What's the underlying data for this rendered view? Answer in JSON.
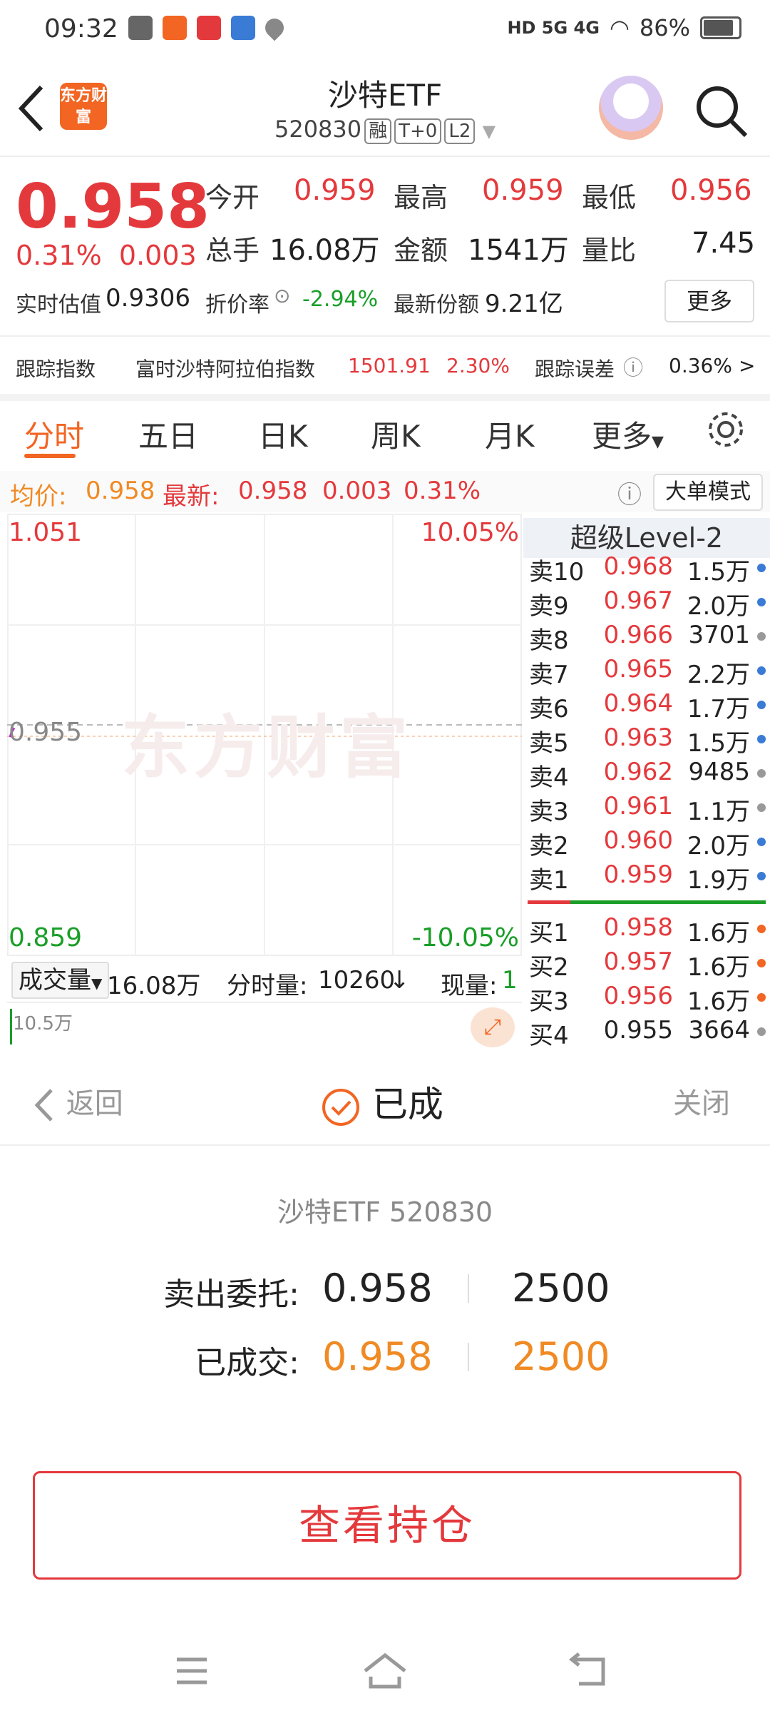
{
  "status_bar": {
    "time": "09:32",
    "network": "HD 5G 4G",
    "battery": "86%"
  },
  "header": {
    "logo_text": "东方财富",
    "title": "沙特ETF",
    "code": "520830",
    "tags": [
      "融",
      "T+0",
      "L2"
    ]
  },
  "quote": {
    "price": "0.958",
    "change_pct": "0.31%",
    "change": "0.003",
    "open_label": "今开",
    "open": "0.959",
    "high_label": "最高",
    "high": "0.959",
    "low_label": "最低",
    "low": "0.956",
    "volume_label": "总手",
    "volume": "16.08万",
    "amount_label": "金额",
    "amount": "1541万",
    "ratio_label": "量比",
    "ratio": "7.45",
    "iopv_label": "实时估值",
    "iopv": "0.9306",
    "discount_label": "折价率",
    "discount": "-2.94%",
    "shares_label": "最新份额",
    "shares": "9.21亿",
    "more_label": "更多"
  },
  "tracking": {
    "label": "跟踪指数",
    "index_name": "富时沙特阿拉伯指数",
    "index_value": "1501.91",
    "index_pct": "2.30%",
    "error_label": "跟踪误差",
    "error_value": "0.36%",
    "arrow": ">"
  },
  "tabs": {
    "items": [
      "分时",
      "五日",
      "日K",
      "周K",
      "月K",
      "更多"
    ],
    "active": "分时"
  },
  "avg_row": {
    "avg_label": "均价:",
    "avg": "0.958",
    "latest_label": "最新:",
    "latest": "0.958",
    "latest_change": "0.003",
    "latest_pct": "0.31%",
    "mode_button": "大单模式"
  },
  "chart": {
    "y_top": "1.051",
    "y_top_pct": "10.05%",
    "y_mid": "0.955",
    "y_bottom": "0.859",
    "y_bottom_pct": "-10.05%",
    "watermark": "东方财富"
  },
  "chart_data": {
    "type": "line",
    "ylim": [
      0.859,
      1.051
    ],
    "reference": 0.955,
    "series": [
      {
        "values": [
          0.954,
          0.956,
          0.957,
          0.958
        ]
      }
    ]
  },
  "volume_bar": {
    "dropdown": "成交量",
    "total": "16.08万",
    "tick_label": "分时量:",
    "tick_value": "10260",
    "tick_arrow": "↓",
    "current_label": "现量:",
    "current_value": "1",
    "axis_max": "10.5万"
  },
  "order_book": {
    "title": "超级Level-2",
    "asks": [
      {
        "label": "卖10",
        "price": "0.968",
        "vol": "1.5万",
        "dot": "#3a7bd5"
      },
      {
        "label": "卖9",
        "price": "0.967",
        "vol": "2.0万",
        "dot": "#3a7bd5"
      },
      {
        "label": "卖8",
        "price": "0.966",
        "vol": "3701",
        "dot": "#999999"
      },
      {
        "label": "卖7",
        "price": "0.965",
        "vol": "2.2万",
        "dot": "#3a7bd5"
      },
      {
        "label": "卖6",
        "price": "0.964",
        "vol": "1.7万",
        "dot": "#3a7bd5"
      },
      {
        "label": "卖5",
        "price": "0.963",
        "vol": "1.5万",
        "dot": "#3a7bd5"
      },
      {
        "label": "卖4",
        "price": "0.962",
        "vol": "9485",
        "dot": "#999999"
      },
      {
        "label": "卖3",
        "price": "0.961",
        "vol": "1.1万",
        "dot": "#999999"
      },
      {
        "label": "卖2",
        "price": "0.960",
        "vol": "2.0万",
        "dot": "#3a7bd5"
      },
      {
        "label": "卖1",
        "price": "0.959",
        "vol": "1.9万",
        "dot": "#3a7bd5"
      }
    ],
    "bids": [
      {
        "label": "买1",
        "price": "0.958",
        "vol": "1.6万",
        "dot": "#f26522"
      },
      {
        "label": "买2",
        "price": "0.957",
        "vol": "1.6万",
        "dot": "#f26522"
      },
      {
        "label": "买3",
        "price": "0.956",
        "vol": "1.6万",
        "dot": "#f26522"
      },
      {
        "label": "买4",
        "price": "0.955",
        "vol": "3664",
        "dot": "#999999"
      }
    ]
  },
  "dialog": {
    "back_label": "返回",
    "status": "已成",
    "close_label": "关闭",
    "stock": "沙特ETF 520830",
    "order_label": "卖出委托:",
    "order_price": "0.958",
    "order_qty": "2500",
    "filled_label": "已成交:",
    "filled_price": "0.958",
    "filled_qty": "2500",
    "button": "查看持仓"
  },
  "colors": {
    "up": "#e4393c",
    "down": "#1a9e28",
    "accent": "#f26522",
    "filled": "#f08a24"
  }
}
